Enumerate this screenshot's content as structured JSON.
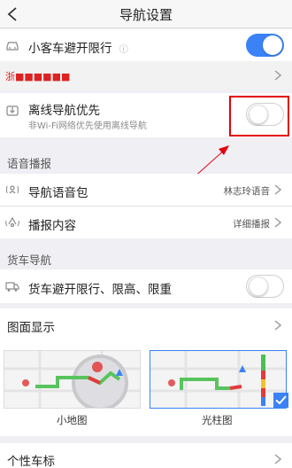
{
  "header": {
    "title": "导航设置"
  },
  "car_limit": {
    "label": "小客车避开限行",
    "info_icon": "ⓘ",
    "enabled": true
  },
  "plate_row": {
    "value": "浙■■■■■■"
  },
  "offline_nav": {
    "label": "离线导航优先",
    "sublabel": "非Wi-Fi网络优先使用离线导航",
    "enabled": false
  },
  "voice_section": {
    "title": "语音播报"
  },
  "voice_package": {
    "label": "导航语音包",
    "value": "林志玲语音"
  },
  "broadcast_content": {
    "label": "播报内容",
    "value": "详细播报"
  },
  "truck_section": {
    "title": "货车导航"
  },
  "truck_avoid": {
    "label": "货车避开限行、限高、限重",
    "enabled": false
  },
  "map_display": {
    "label": "图面显示"
  },
  "previews": [
    {
      "caption": "小地图",
      "selected": false
    },
    {
      "caption": "光柱图",
      "selected": true
    }
  ],
  "car_icon_row": {
    "label": "个性车标"
  },
  "colors": {
    "accent": "#3a82f6",
    "highlight": "#e3000b"
  }
}
